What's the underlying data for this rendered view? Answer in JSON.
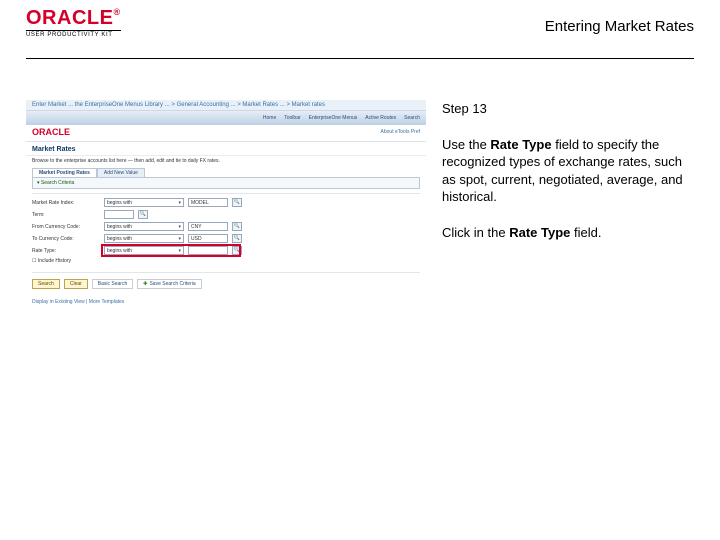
{
  "header": {
    "brand_main": "ORACLE",
    "brand_tm": "®",
    "brand_sub": "USER PRODUCTIVITY KIT",
    "doc_title": "Entering Market Rates"
  },
  "screenshot": {
    "window_title": "Enter Market ... the EnterpriseOne Menus Library ...  > General Accounting ... > Market Rates ... > Market rates",
    "menubar": [
      "Home",
      "Toolbar",
      "EnterpriseOne Menus",
      "Active Routes",
      "Search"
    ],
    "brand": "ORACLE",
    "help_text": "About eTools   Pref",
    "section_title": "Market Rates",
    "desc": "Browse to the enterprise accounts list here — then add, edit and tie to daily FX rates.",
    "tabs": [
      "Market Posting Rates",
      "Add New Value"
    ],
    "search_label": "▾ Search Criteria",
    "form": {
      "row1_label": "Market Rate Index:",
      "row1_value": "begins with",
      "row1_code": "MODEL",
      "row2_label": "Term:",
      "row2_value": "",
      "row3_label": "From Currency Code:",
      "row3_value": "begins with",
      "row3_code": "CNY",
      "row4_label": "To Currency Code:",
      "row4_value": "begins with",
      "row4_code": "USD",
      "row5_label": "Rate Type:",
      "row5_value": "begins with",
      "row6_label": "☐ Include History"
    },
    "buttons": {
      "search": "Search",
      "clear": "Clear",
      "basic": "Basic Search",
      "save": "Save Search Criteria"
    },
    "footer": "Display in Existing View  |  More Templates"
  },
  "instructions": {
    "step_label": "Step 13",
    "p1_a": "Use the ",
    "p1_bold": "Rate Type",
    "p1_b": " field to specify the recognized types of exchange rates, such as spot, current, negotiated, average, and historical.",
    "p2_a": "Click in the ",
    "p2_bold": "Rate Type",
    "p2_b": " field."
  }
}
